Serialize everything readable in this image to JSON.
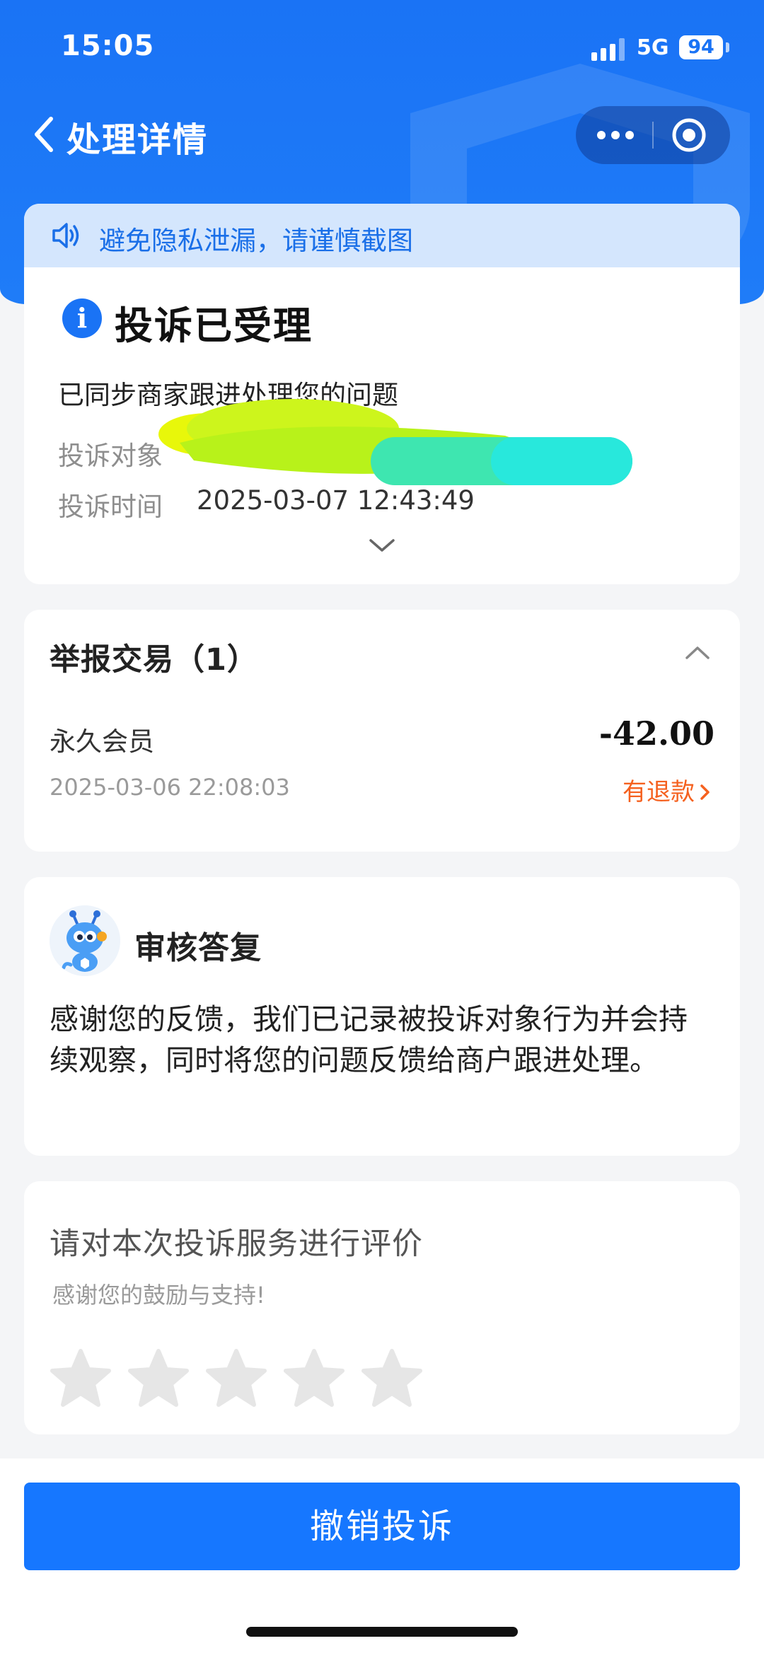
{
  "status_bar": {
    "time": "15:05",
    "network": "5G",
    "battery": "94"
  },
  "nav": {
    "title": "处理详情",
    "back_icon": "chevron-left-icon",
    "more_icon": "more-dots-icon",
    "close_icon": "target-icon"
  },
  "notice": {
    "icon": "speaker-icon",
    "text": "避免隐私泄漏，请谨慎截图"
  },
  "complaint_status": {
    "icon": "info-icon",
    "title": "投诉已受理",
    "description": "已同步商家跟进处理您的问题",
    "target_label": "投诉对象",
    "time_label": "投诉时间",
    "time_value": "2025-03-07 12:43:49",
    "expand_icon": "chevron-down-icon"
  },
  "transactions": {
    "title": "举报交易（1）",
    "collapse_icon": "chevron-up-icon",
    "items": [
      {
        "name": "永久会员",
        "amount": "-42.00",
        "time": "2025-03-06 22:08:03",
        "status": "有退款"
      }
    ]
  },
  "review": {
    "avatar_icon": "robot-ant-avatar-icon",
    "title": "审核答复",
    "body": "感谢您的反馈，我们已记录被投诉对象行为并会持续观察，同时将您的问题反馈给商户跟进处理。"
  },
  "rating": {
    "title": "请对本次投诉服务进行评价",
    "subtitle": "感谢您的鼓励与支持!",
    "rating_value": 0,
    "rating_max": 5,
    "star_icon": "star-icon"
  },
  "actions": {
    "cancel_label": "撤销投诉"
  },
  "colors": {
    "brand_blue": "#1677ff",
    "refund_orange": "#f5611f",
    "notice_bg": "#d4e6fd"
  }
}
